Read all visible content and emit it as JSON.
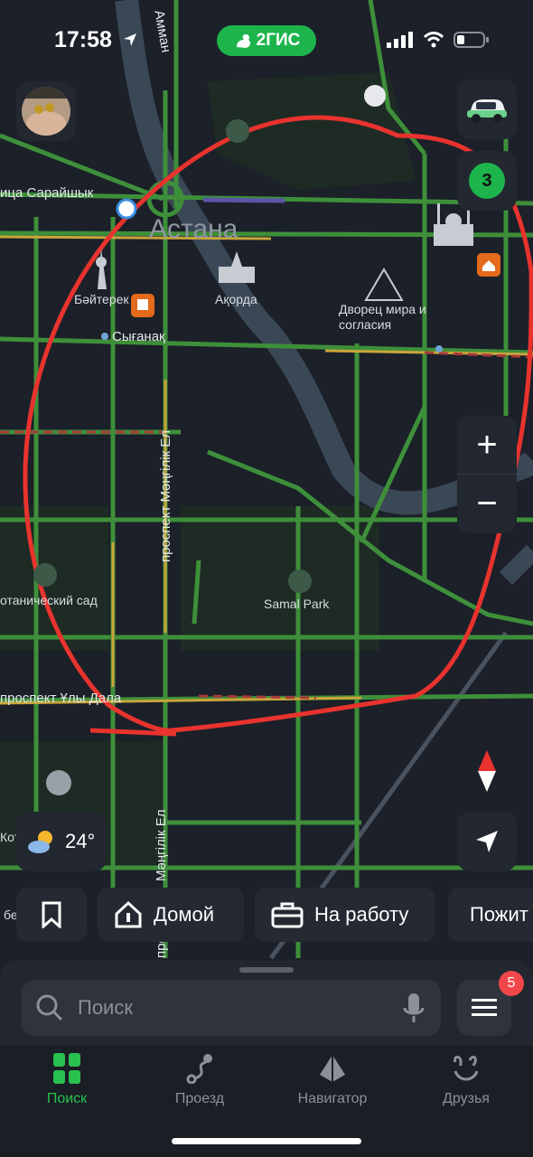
{
  "status_bar": {
    "time": "17:58",
    "brand": "2ГИС"
  },
  "map": {
    "city": "Астана",
    "labels": {
      "saraishyk": "ица Сарайшык",
      "ammann": "Амман",
      "baiterek": "Бәйтерек",
      "akorda": "Ақорда",
      "dvorets": "Дворец мира и\nсогласия",
      "syganak": "Сығанақ",
      "prospekt_mangilik": "проспект Мәңгілік Ел",
      "botanic": "отанический сад",
      "samal": "Samal Park",
      "uly_dala": "проспект Ұлы Дала",
      "mangilik2": "Мәңгілік Ел",
      "kot": "Кот",
      "be": "бе",
      "prospekt2": "проспект"
    }
  },
  "controls": {
    "layers_count": "3",
    "zoom_in": "+",
    "zoom_out": "−"
  },
  "weather": {
    "temp": "24°"
  },
  "quick": {
    "home": "Домой",
    "work": "На работу",
    "more": "Пожит"
  },
  "search": {
    "placeholder": "Поиск",
    "menu_badge": "5"
  },
  "tabs": [
    {
      "label": "Поиск"
    },
    {
      "label": "Проезд"
    },
    {
      "label": "Навигатор"
    },
    {
      "label": "Друзья"
    }
  ],
  "colors": {
    "accent": "#28c14f",
    "annotation": "#e8332e",
    "traffic_green": "#3e8f3a"
  }
}
